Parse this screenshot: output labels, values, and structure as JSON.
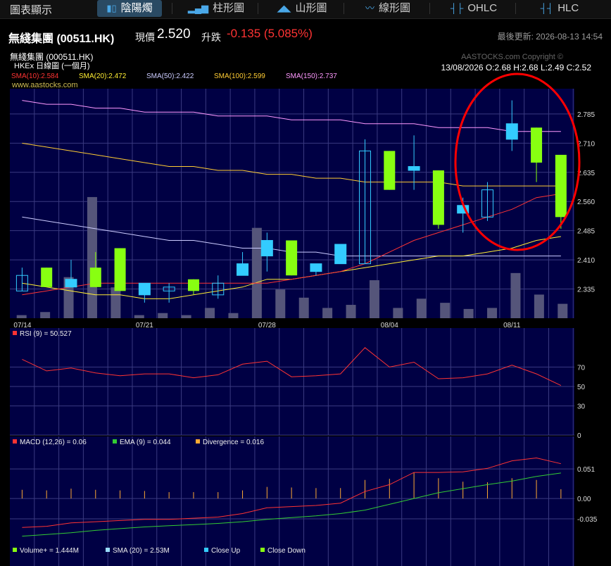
{
  "topbar": {
    "label": "圖表顯示",
    "tabs": [
      {
        "label": "陰陽燭",
        "icon": "candlestick-icon",
        "active": true
      },
      {
        "label": "柱形圖",
        "icon": "bar-chart-icon",
        "active": false
      },
      {
        "label": "山形圖",
        "icon": "mountain-chart-icon",
        "active": false
      },
      {
        "label": "線形圖",
        "icon": "line-chart-icon",
        "active": false
      },
      {
        "label": "OHLC",
        "icon": "ohlc-icon",
        "active": false
      },
      {
        "label": "HLC",
        "icon": "hlc-icon",
        "active": false
      }
    ]
  },
  "quote": {
    "name": "無綫集團 (00511.HK)",
    "price_label": "現價",
    "price": "2.520",
    "change_label": "升跌",
    "change": "-0.135 (5.085%)",
    "updated": "最後更新: 2026-08-13 14:54"
  },
  "colors": {
    "up": "#33ccff",
    "down": "#88ff11",
    "grid": "#3a3a80",
    "bg": "#000044"
  },
  "chart_data": [
    {
      "type": "candlestick",
      "title": "無綫集團 (000511.HK)",
      "subtitle": "HKEx 日線圖 (一個月)",
      "watermark": "AASTOCKS.com Copyright ©",
      "site": "www.aastocks.com",
      "last_bar_text": "13/08/2026  O:2.68  H:2.68  L:2.49  C:2.52",
      "sma_legend": [
        {
          "text": "SMA(10):2.584",
          "color": "#ff3333"
        },
        {
          "text": "SMA(20):2.472",
          "color": "#ffee33"
        },
        {
          "text": "SMA(50):2.422",
          "color": "#ccccff"
        },
        {
          "text": "SMA(100):2.599",
          "color": "#ffcc33"
        },
        {
          "text": "SMA(150):2.737",
          "color": "#ff99ff"
        }
      ],
      "ylim": [
        2.26,
        2.85
      ],
      "yticks": [
        "2.785",
        "2.710",
        "2.635",
        "2.560",
        "2.485",
        "2.410",
        "2.335"
      ],
      "x_tick_labels": [
        {
          "index": 0,
          "label": "07/14"
        },
        {
          "index": 5,
          "label": "07/21"
        },
        {
          "index": 10,
          "label": "07/28"
        },
        {
          "index": 15,
          "label": "08/04"
        },
        {
          "index": 20,
          "label": "08/11"
        }
      ],
      "ohlc": [
        [
          2.33,
          2.39,
          2.33,
          2.37
        ],
        [
          2.39,
          2.39,
          2.34,
          2.34
        ],
        [
          2.34,
          2.41,
          2.34,
          2.36
        ],
        [
          2.39,
          2.43,
          2.34,
          2.34
        ],
        [
          2.44,
          2.44,
          2.33,
          2.33
        ],
        [
          2.32,
          2.33,
          2.3,
          2.35
        ],
        [
          2.33,
          2.35,
          2.3,
          2.34
        ],
        [
          2.36,
          2.36,
          2.32,
          2.33
        ],
        [
          2.32,
          2.37,
          2.31,
          2.35
        ],
        [
          2.37,
          2.43,
          2.37,
          2.4
        ],
        [
          2.42,
          2.48,
          2.38,
          2.46
        ],
        [
          2.46,
          2.46,
          2.37,
          2.37
        ],
        [
          2.38,
          2.4,
          2.37,
          2.4
        ],
        [
          2.4,
          2.45,
          2.4,
          2.45
        ],
        [
          2.4,
          2.72,
          2.4,
          2.69
        ],
        [
          2.69,
          2.69,
          2.59,
          2.59
        ],
        [
          2.64,
          2.73,
          2.59,
          2.65
        ],
        [
          2.64,
          2.64,
          2.49,
          2.5
        ],
        [
          2.53,
          2.57,
          2.48,
          2.55
        ],
        [
          2.52,
          2.61,
          2.51,
          2.59
        ],
        [
          2.72,
          2.82,
          2.69,
          2.76
        ],
        [
          2.75,
          2.75,
          2.61,
          2.66
        ],
        [
          2.68,
          2.68,
          2.49,
          2.52
        ]
      ],
      "volume": [
        0.3,
        0.6,
        4.0,
        11.8,
        3.0,
        0.3,
        0.5,
        0.3,
        1.0,
        0.5,
        8.8,
        2.8,
        2.0,
        1.0,
        1.3,
        3.7,
        1.0,
        1.9,
        1.5,
        0.9,
        1.0,
        4.4,
        2.3,
        1.4
      ],
      "volume_max": 12,
      "sma10": [
        2.32,
        2.33,
        2.34,
        2.35,
        2.35,
        2.35,
        2.35,
        2.35,
        2.35,
        2.35,
        2.35,
        2.36,
        2.37,
        2.38,
        2.4,
        2.43,
        2.46,
        2.48,
        2.5,
        2.52,
        2.54,
        2.57,
        2.58
      ],
      "sma20": [
        2.35,
        2.34,
        2.33,
        2.32,
        2.32,
        2.31,
        2.31,
        2.32,
        2.33,
        2.34,
        2.36,
        2.36,
        2.37,
        2.38,
        2.39,
        2.4,
        2.41,
        2.42,
        2.42,
        2.43,
        2.44,
        2.46,
        2.47
      ],
      "sma50": [
        2.52,
        2.51,
        2.5,
        2.49,
        2.48,
        2.47,
        2.46,
        2.46,
        2.45,
        2.44,
        2.44,
        2.43,
        2.43,
        2.42,
        2.42,
        2.42,
        2.42,
        2.42,
        2.42,
        2.42,
        2.42,
        2.42,
        2.42
      ],
      "sma100": [
        2.71,
        2.7,
        2.69,
        2.68,
        2.67,
        2.66,
        2.65,
        2.65,
        2.64,
        2.64,
        2.63,
        2.63,
        2.62,
        2.62,
        2.61,
        2.61,
        2.61,
        2.61,
        2.6,
        2.6,
        2.6,
        2.6,
        2.6
      ],
      "sma150": [
        2.82,
        2.81,
        2.81,
        2.8,
        2.8,
        2.79,
        2.79,
        2.79,
        2.78,
        2.78,
        2.78,
        2.77,
        2.77,
        2.77,
        2.76,
        2.76,
        2.76,
        2.75,
        2.75,
        2.75,
        2.74,
        2.74,
        2.74
      ]
    },
    {
      "type": "line",
      "title": "RSI (9) = 50.527",
      "ylim": [
        0,
        100
      ],
      "yticks": [
        "70",
        "50",
        "30",
        "0"
      ],
      "series": [
        {
          "name": "RSI (9) = 50.527",
          "color": "#ff3333",
          "values": [
            78,
            66,
            69,
            64,
            61,
            63,
            63,
            59,
            62,
            73,
            76,
            60,
            61,
            63,
            90,
            70,
            75,
            58,
            59,
            63,
            72,
            63,
            51
          ]
        }
      ]
    },
    {
      "type": "line",
      "title": "MACD",
      "ylim": [
        -0.08,
        0.09
      ],
      "yticks": [
        "0.051",
        "0.00",
        "-0.035"
      ],
      "legend": [
        {
          "text": "MACD (12,26) = 0.06",
          "color": "#ff3333"
        },
        {
          "text": "EMA (9) = 0.044",
          "color": "#33cc33"
        },
        {
          "text": "Divergence = 0.016",
          "color": "#ffaa33"
        }
      ],
      "series": [
        {
          "name": "MACD (12,26) = 0.06",
          "color": "#ff3333",
          "values": [
            -0.05,
            -0.048,
            -0.042,
            -0.04,
            -0.038,
            -0.036,
            -0.036,
            -0.034,
            -0.032,
            -0.026,
            -0.016,
            -0.014,
            -0.012,
            -0.008,
            0.012,
            0.024,
            0.045,
            0.045,
            0.046,
            0.052,
            0.065,
            0.07,
            0.06
          ]
        },
        {
          "name": "EMA (9) = 0.044",
          "color": "#33cc33",
          "values": [
            -0.065,
            -0.062,
            -0.059,
            -0.055,
            -0.052,
            -0.049,
            -0.047,
            -0.045,
            -0.043,
            -0.04,
            -0.036,
            -0.033,
            -0.03,
            -0.026,
            -0.02,
            -0.01,
            0.0,
            0.01,
            0.017,
            0.024,
            0.03,
            0.038,
            0.044
          ]
        },
        {
          "name": "Divergence = 0.016",
          "color": "#ffaa33",
          "bars": true,
          "values": [
            0.015,
            0.014,
            0.017,
            0.015,
            0.014,
            0.013,
            0.011,
            0.011,
            0.011,
            0.014,
            0.02,
            0.019,
            0.018,
            0.018,
            0.032,
            0.034,
            0.045,
            0.035,
            0.029,
            0.028,
            0.035,
            0.032,
            0.016
          ]
        }
      ]
    },
    {
      "type": "legend_strip",
      "legend": [
        {
          "text": "Volume+ = 1.444M",
          "color": "#88ff11"
        },
        {
          "text": "SMA (20) = 2.53M",
          "color": "#99ddff"
        },
        {
          "text": "Close Up",
          "color": "#33ccff"
        },
        {
          "text": "Close Down",
          "color": "#88ff11"
        }
      ]
    }
  ]
}
